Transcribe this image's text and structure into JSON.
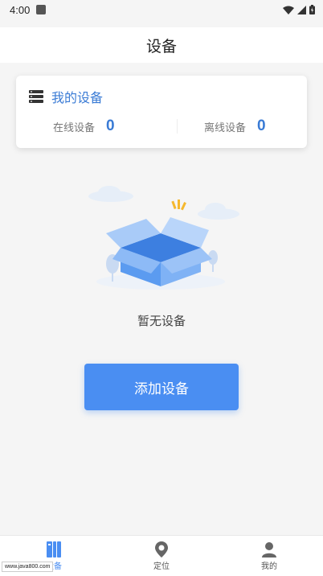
{
  "status_bar": {
    "time": "4:00"
  },
  "header": {
    "title": "设备"
  },
  "card": {
    "title": "我的设备",
    "online": {
      "label": "在线设备",
      "value": "0"
    },
    "offline": {
      "label": "离线设备",
      "value": "0"
    }
  },
  "empty": {
    "text": "暂无设备"
  },
  "add_button": {
    "label": "添加设备"
  },
  "bottom_nav": {
    "items": [
      {
        "label": "设备",
        "icon": "devices-icon",
        "active": true
      },
      {
        "label": "定位",
        "icon": "location-pin-icon",
        "active": false
      },
      {
        "label": "我的",
        "icon": "person-icon",
        "active": false
      }
    ]
  },
  "watermark": "www.java800.com",
  "colors": {
    "accent": "#4a8ef2",
    "title_blue": "#3a7bd5"
  }
}
